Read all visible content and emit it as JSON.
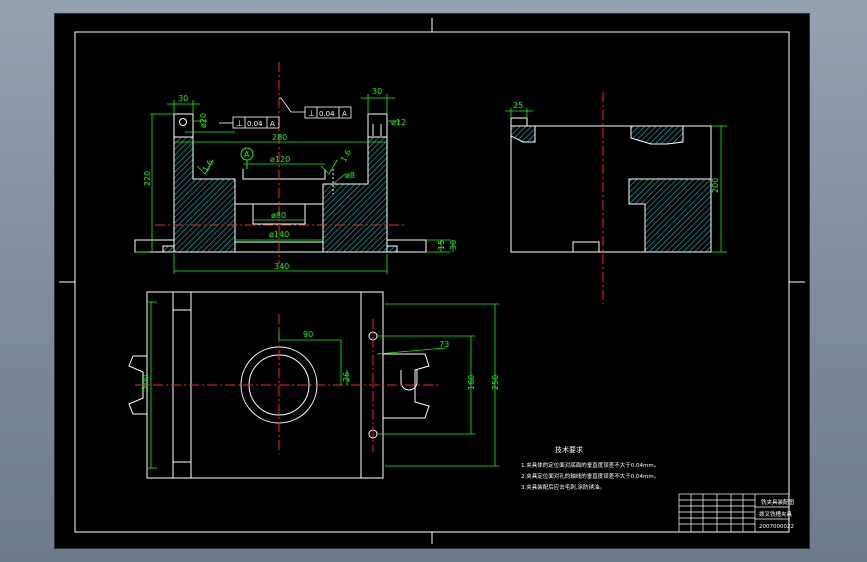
{
  "colors": {
    "background": "#000000",
    "frame": "#ffffff",
    "dimension": "#00ff00",
    "hatch": "#00c8c8",
    "centerline": "#ff2020",
    "tolerance": "#ffffff"
  },
  "front_view": {
    "dim_top_left": "30",
    "dim_top_right": "30",
    "dia_20": "ø20",
    "dia_12": "ø12",
    "dim_280": "280",
    "dia_120": "ø120",
    "dia_80": "ø80",
    "dia_140": "ø140",
    "dim_340": "340",
    "dim_220": "220",
    "dim_15": "15",
    "dim_30_right": "30",
    "dia_8": "ø8",
    "roughness_left": "1.6",
    "roughness_right": "1.6",
    "datum_label": "A",
    "tolerance_frames": [
      {
        "symbol": "⊥",
        "value": "0.04",
        "datum": "A"
      },
      {
        "symbol": "⊥",
        "value": "0.04",
        "datum": "A"
      }
    ]
  },
  "side_view": {
    "dim_25": "25",
    "dim_200": "200"
  },
  "top_view": {
    "dim_90": "90",
    "dim_73": "73",
    "dim_300": "300",
    "dim_160": "160",
    "dim_250": "250",
    "dim_26": "26"
  },
  "notes": {
    "title": "技术要求",
    "lines": [
      "1.夹具体的定位面对底面的垂直度误差不大于0.04mm。",
      "2.夹具定位面对孔的轴线的垂直度误差不大于0.04mm。",
      "3.夹具装配后应去毛刺,涂防锈油。"
    ]
  },
  "title_block": {
    "part_name": "铣夹具装配图",
    "product_name": "拨叉铣槽夹具",
    "drawing_no": "2007000022"
  }
}
